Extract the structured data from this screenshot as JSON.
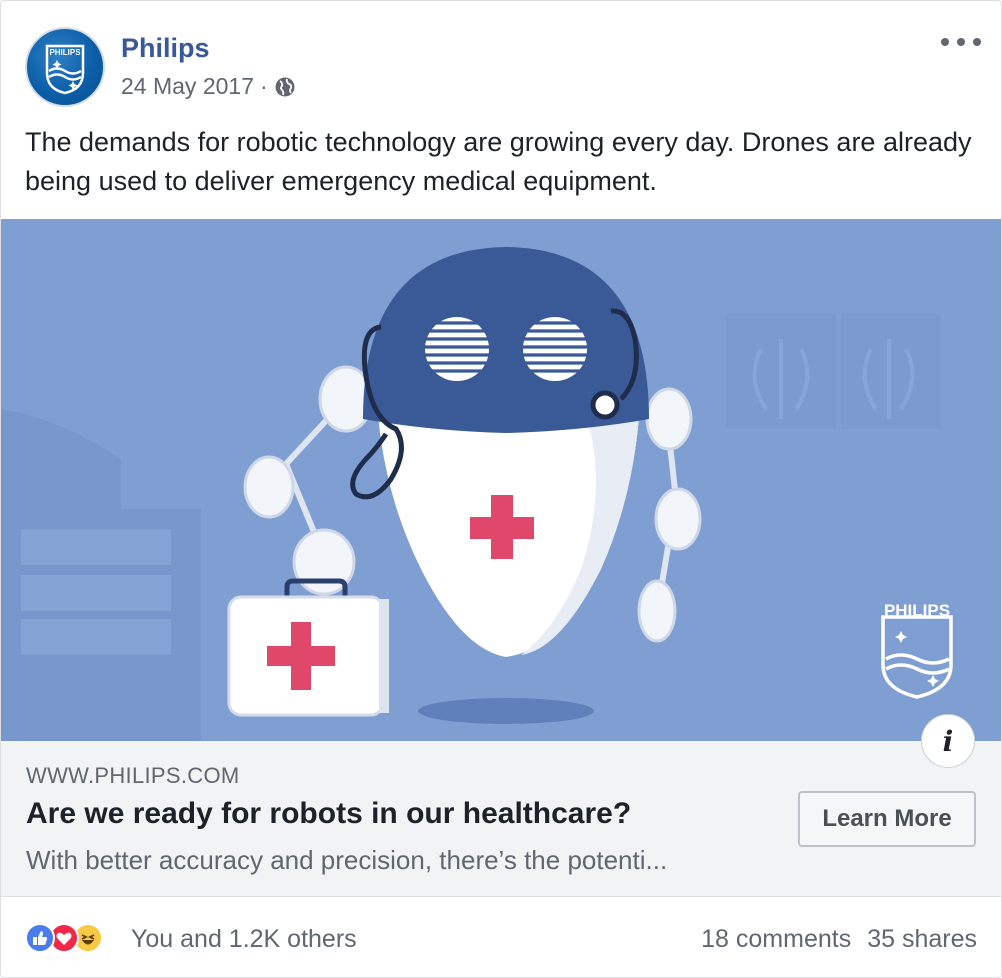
{
  "post": {
    "page_name": "Philips",
    "date": "24 May 2017",
    "separator": "·",
    "privacy_icon": "globe-icon",
    "more_icon": "more-options-icon",
    "text": "The demands for robotic technology are growing every day. Drones are already being used to deliver emergency medical equipment."
  },
  "avatar": {
    "logo_text": "PHILIPS"
  },
  "image": {
    "watermark_text": "PHILIPS",
    "colors": {
      "background": "#7f9fd3",
      "helmet": "#3a5a97",
      "cross": "#e0486b",
      "body": "#ffffff"
    }
  },
  "link_preview": {
    "domain": "WWW.PHILIPS.COM",
    "headline": "Are we ready for robots in our healthcare?",
    "description": "With better accuracy and precision, there’s the potenti...",
    "cta_label": "Learn More",
    "info_label": "i"
  },
  "footer": {
    "reactions": [
      "like-icon",
      "love-icon",
      "haha-icon"
    ],
    "reaction_text": "You and 1.2K others",
    "comments": "18 comments",
    "shares": "35 shares"
  }
}
